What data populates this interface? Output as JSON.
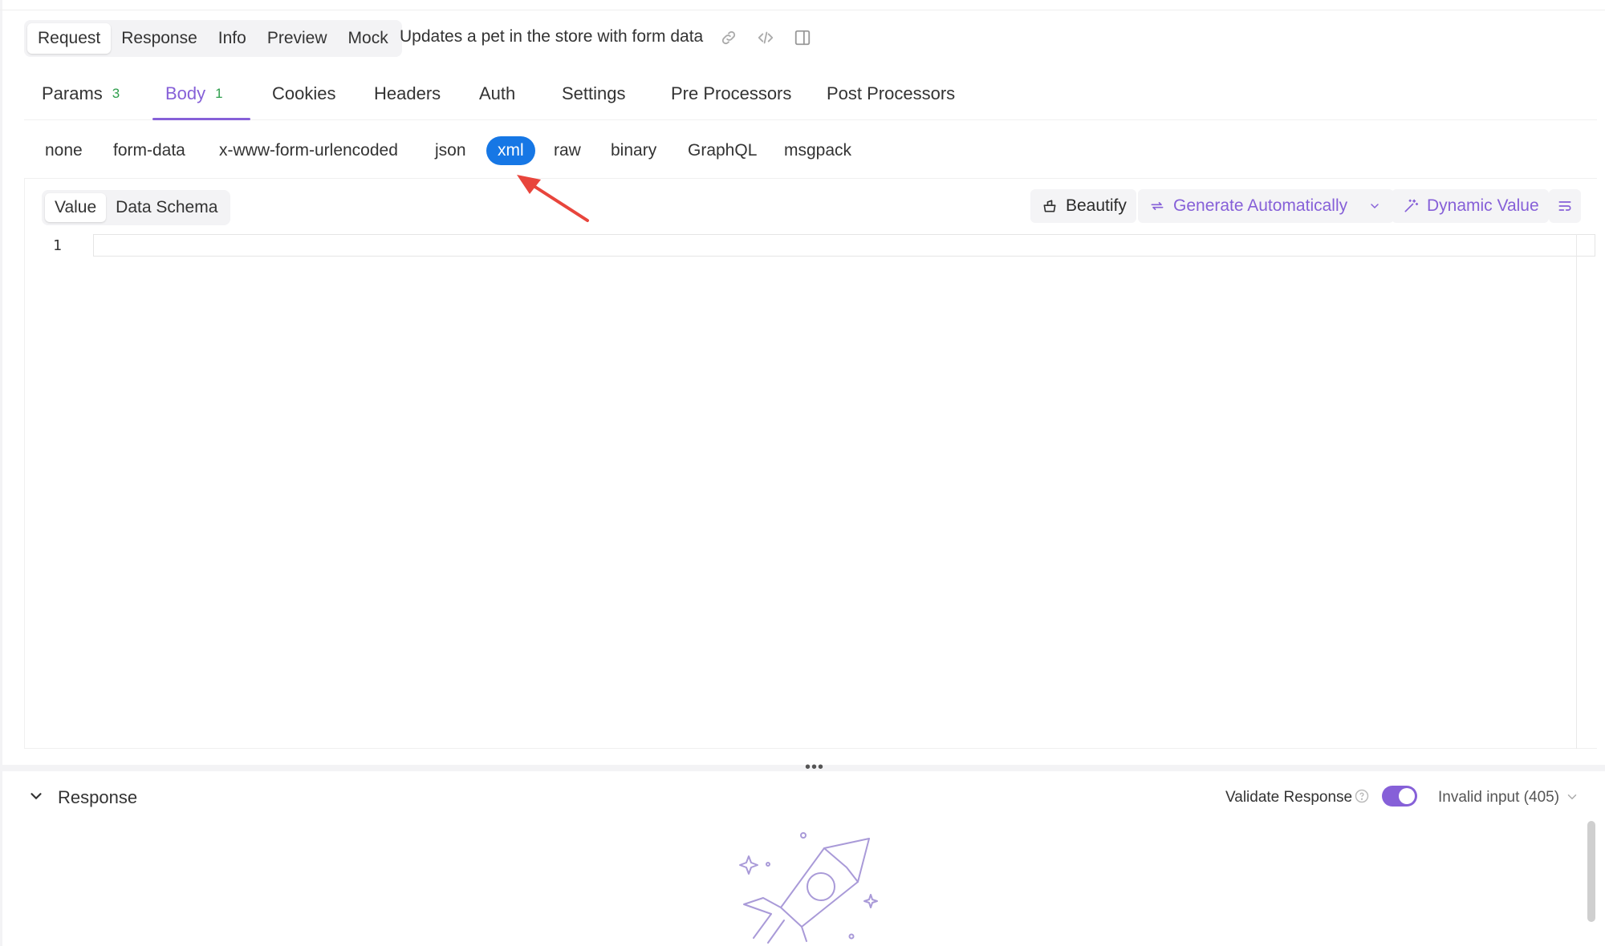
{
  "request_bar": {
    "modes": [
      "Request",
      "Response",
      "Info",
      "Preview",
      "Mock"
    ],
    "active_mode": "Request",
    "endpoint_title": "Updates a pet in the store with form data",
    "icons": [
      "link-icon",
      "code-icon",
      "split-view-icon"
    ]
  },
  "tabs": [
    {
      "label": "Params",
      "badge": "3"
    },
    {
      "label": "Body",
      "badge": "1"
    },
    {
      "label": "Cookies",
      "badge": ""
    },
    {
      "label": "Headers",
      "badge": ""
    },
    {
      "label": "Auth",
      "badge": ""
    },
    {
      "label": "Settings",
      "badge": ""
    },
    {
      "label": "Pre Processors",
      "badge": ""
    },
    {
      "label": "Post Processors",
      "badge": ""
    }
  ],
  "active_tab": "Body",
  "body_types": [
    "none",
    "form-data",
    "x-www-form-urlencoded",
    "json",
    "xml",
    "raw",
    "binary",
    "GraphQL",
    "msgpack"
  ],
  "active_body_type": "xml",
  "editor": {
    "value_tabs": [
      "Value",
      "Data Schema"
    ],
    "active_value_tab": "Value",
    "beautify_label": "Beautify",
    "generate_label": "Generate Automatically",
    "dynamic_value_label": "Dynamic Value",
    "line_number": "1",
    "content": ""
  },
  "splitter_dots": "•••",
  "response": {
    "title": "Response",
    "validate_label": "Validate Response",
    "validate_enabled": true,
    "status_option": "Invalid input (405)"
  },
  "colors": {
    "accent": "#8660d8",
    "pill_active": "#1677e5",
    "badge": "#2e9e4c",
    "annotation": "#e8453c"
  }
}
